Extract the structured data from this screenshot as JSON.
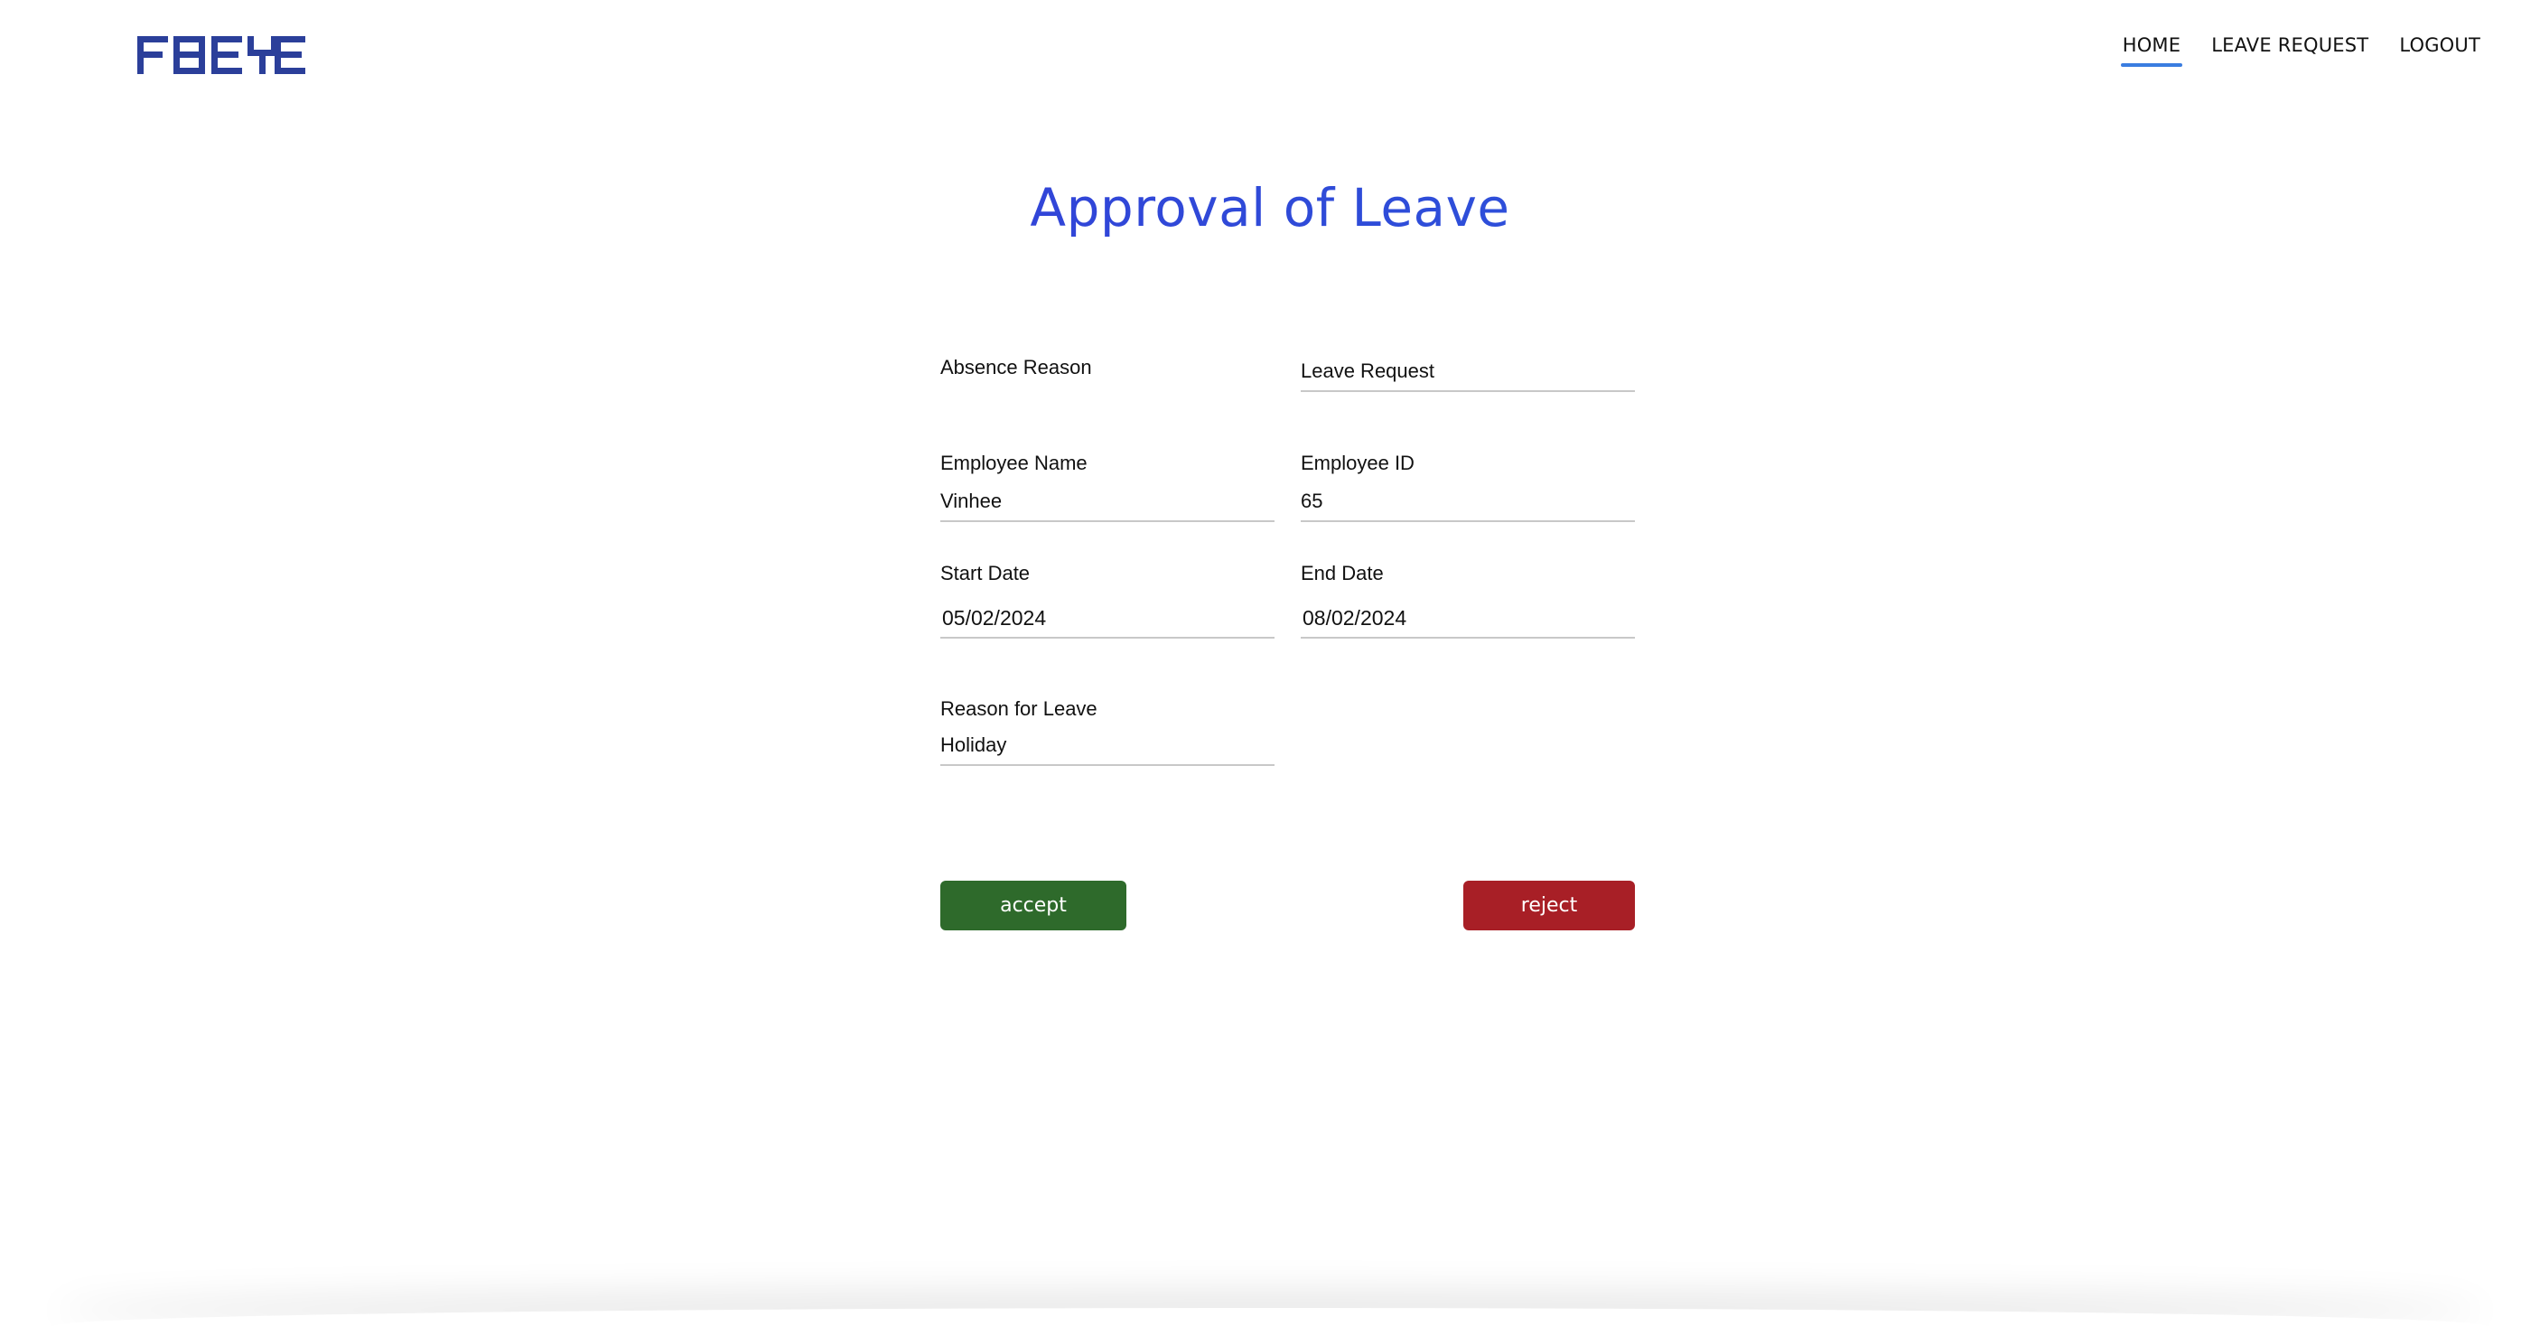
{
  "brand": {
    "logo_text": "FBEYE",
    "logo_color": "#2b3f9a"
  },
  "nav": {
    "items": [
      {
        "label": "HOME",
        "active": true
      },
      {
        "label": "LEAVE REQUEST",
        "active": false
      },
      {
        "label": "LOGOUT",
        "active": false
      }
    ],
    "active_underline_color": "#3a7de0"
  },
  "page": {
    "title": "Approval of Leave",
    "title_color": "#2f4ad8"
  },
  "form": {
    "absence_reason": {
      "label": "Absence Reason"
    },
    "leave_request": {
      "value": "Leave Request"
    },
    "employee_name": {
      "label": "Employee Name",
      "value": "Vinhee"
    },
    "employee_id": {
      "label": "Employee ID",
      "value": "65"
    },
    "start_date": {
      "label": "Start Date",
      "value": "05/02/2024"
    },
    "end_date": {
      "label": "End Date",
      "value": "08/02/2024"
    },
    "reason_for_leave": {
      "label": "Reason for Leave",
      "value": "Holiday"
    }
  },
  "actions": {
    "accept_label": "accept",
    "accept_color": "#2e6a2b",
    "reject_label": "reject",
    "reject_color": "#a81f26"
  }
}
